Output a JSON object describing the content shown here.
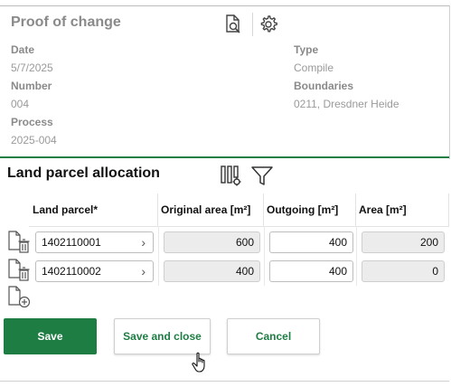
{
  "header": {
    "title": "Proof of change",
    "preview_icon": "document-search-icon",
    "settings_icon": "gear-icon"
  },
  "details": {
    "date_label": "Date",
    "date_value": "5/7/2025",
    "number_label": "Number",
    "number_value": "004",
    "process_label": "Process",
    "process_value": "2025-004",
    "type_label": "Type",
    "type_value": "Compile",
    "boundaries_label": "Boundaries",
    "boundaries_value": "0211, Dresdner Heide"
  },
  "allocation": {
    "title": "Land parcel allocation",
    "columns": {
      "parcel": "Land parcel*",
      "original": "Original area [m²]",
      "outgoing": "Outgoing [m²]",
      "area": "Area [m²]"
    },
    "rows": [
      {
        "parcel": "1402110001",
        "original": "600",
        "outgoing": "400",
        "area": "200"
      },
      {
        "parcel": "1402110002",
        "original": "400",
        "outgoing": "400",
        "area": "0"
      }
    ]
  },
  "actions": {
    "save": "Save",
    "save_close": "Save and close",
    "cancel": "Cancel"
  },
  "colors": {
    "accent": "#1e7d43",
    "readonly_bg": "#ececec"
  }
}
